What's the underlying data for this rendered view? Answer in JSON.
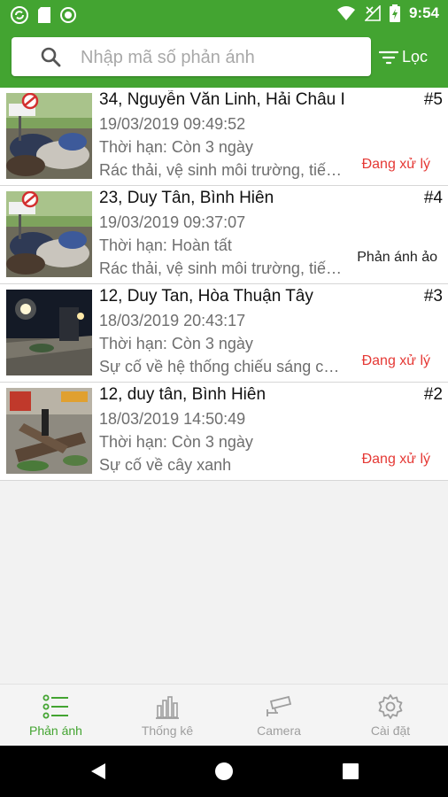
{
  "status_bar": {
    "time": "9:54"
  },
  "search": {
    "placeholder": "Nhập mã số phản ánh"
  },
  "filter_label": "Lọc",
  "reports": [
    {
      "title": "34, Nguyễn Văn Linh, Hải Châu I",
      "number": "#5",
      "timestamp": "19/03/2019 09:49:52",
      "deadline": "Thời hạn: Còn 3 ngày",
      "category": "Rác thải, vệ sinh môi trường, tiếng ồn",
      "status": "Đang xử lý",
      "status_color": "#e53935",
      "image": "garbage-pile"
    },
    {
      "title": "23, Duy Tân, Bình Hiên",
      "number": "#4",
      "timestamp": "19/03/2019 09:37:07",
      "deadline": "Thời hạn: Hoàn tất",
      "category": "Rác thải, vệ sinh môi trường, tiếng ồn",
      "status": "Phản ánh ảo",
      "status_color": "#222222",
      "image": "garbage-pile"
    },
    {
      "title": "12, Duy Tan, Hòa Thuận Tây",
      "number": "#3",
      "timestamp": "18/03/2019 20:43:17",
      "deadline": "Thời hạn: Còn 3 ngày",
      "category": "Sự cố về hệ thống chiếu sáng công cộng",
      "status": "Đang xử lý",
      "status_color": "#e53935",
      "image": "night-street"
    },
    {
      "title": "12, duy tân, Bình Hiên",
      "number": "#2",
      "timestamp": "18/03/2019 14:50:49",
      "deadline": "Thời hạn: Còn 3 ngày",
      "category": "Sự cố về cây xanh",
      "status": "Đang xử lý",
      "status_color": "#e53935",
      "image": "fallen-tree"
    }
  ],
  "bottom_nav": [
    {
      "label": "Phản ánh",
      "icon": "list-icon",
      "active": true
    },
    {
      "label": "Thống kê",
      "icon": "bar-chart-icon",
      "active": false
    },
    {
      "label": "Camera",
      "icon": "cctv-camera-icon",
      "active": false
    },
    {
      "label": "Cài đặt",
      "icon": "gear-icon",
      "active": false
    }
  ],
  "colors": {
    "brand_green": "#43a431",
    "active_tab": "#43a431",
    "inactive_tab": "#9e9e9e"
  }
}
